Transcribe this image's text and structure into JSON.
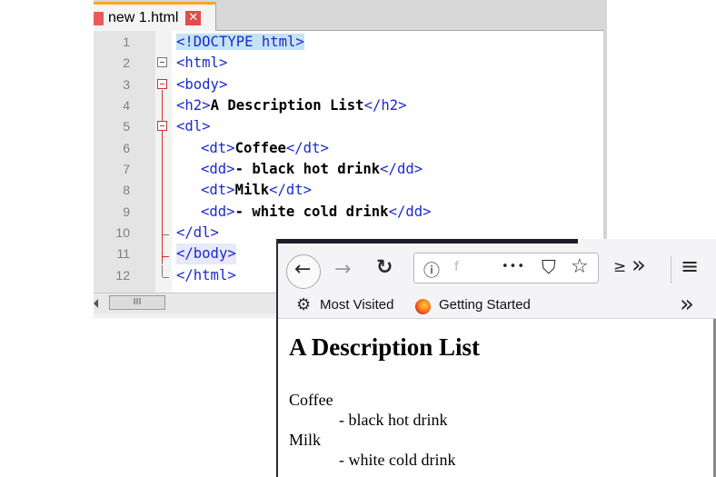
{
  "editor": {
    "tab": {
      "label": "new 1.html",
      "close_glyph": "✕"
    },
    "line_numbers": [
      "1",
      "2",
      "3",
      "4",
      "5",
      "6",
      "7",
      "8",
      "9",
      "10",
      "11",
      "12"
    ],
    "lines": [
      {
        "tag1": "<!DOCTYPE html>"
      },
      {
        "tag1": "<html>"
      },
      {
        "tag1": "<body>"
      },
      {
        "tag1": "<h2>",
        "text": "A Description List",
        "tag2": "</h2>"
      },
      {
        "tag1": "<dl>"
      },
      {
        "tag1": "<dt>",
        "text": "Coffee",
        "tag2": "</dt>"
      },
      {
        "tag1": "<dd>",
        "text": "- black hot drink",
        "tag2": "</dd>"
      },
      {
        "tag1": "<dt>",
        "text": "Milk",
        "tag2": "</dt>"
      },
      {
        "tag1": "<dd>",
        "text": "- white cold drink",
        "tag2": "</dd>"
      },
      {
        "tag1": "</dl>"
      },
      {
        "tag1": "</body>"
      },
      {
        "tag1": "</html>"
      }
    ],
    "scroll_thumb": "III"
  },
  "browser": {
    "nav": {
      "back": "←",
      "forward": "→",
      "reload": "↻",
      "info": "ⓘ",
      "url_text": "f",
      "more": "•••",
      "pocket": "⛉",
      "bookmark_star": "☆",
      "overflow_partial": "≥",
      "extensions": "»",
      "menu": "≡"
    },
    "bookmarks": {
      "most_visited": "Most Visited",
      "getting_started": "Getting Started",
      "gear": "⚙",
      "chevron": "»"
    },
    "page": {
      "heading": "A Description List",
      "items": [
        {
          "term": "Coffee",
          "desc": "- black hot drink"
        },
        {
          "term": "Milk",
          "desc": "- white cold drink"
        }
      ]
    }
  }
}
